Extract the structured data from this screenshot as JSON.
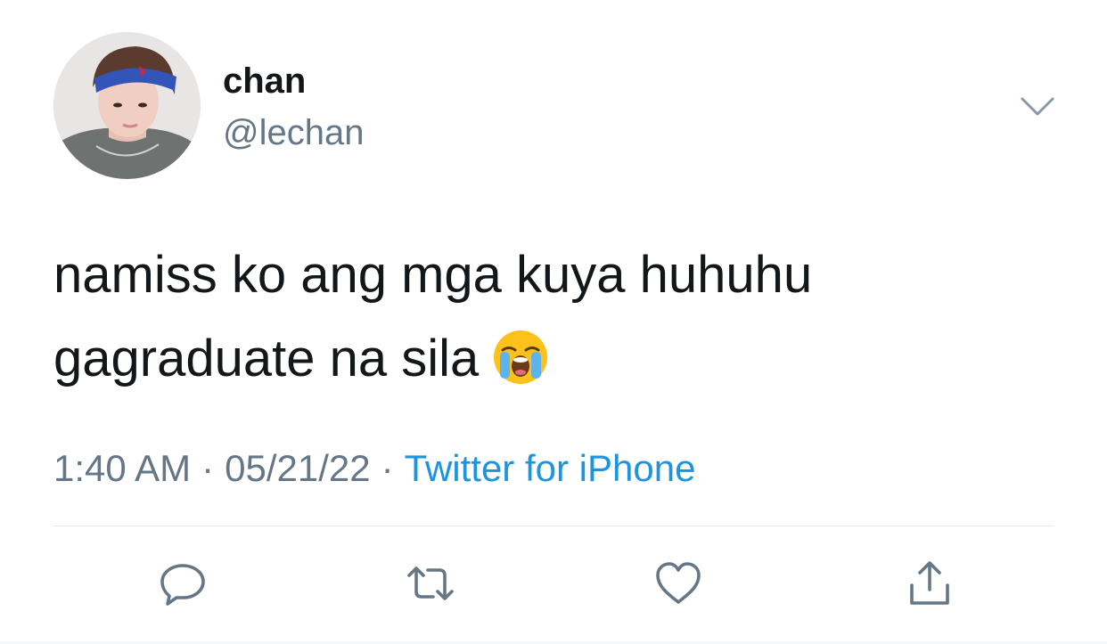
{
  "user": {
    "display_name": "chan",
    "handle": "@lechan",
    "avatar_icon": "profile-photo"
  },
  "tweet": {
    "text_lines": [
      "namiss ko ang mga kuya huhuhu",
      "gagraduate na sila"
    ],
    "emoji": "loudly-crying-face-emoji",
    "time": "1:40 AM",
    "separator": "·",
    "date": "05/21/22",
    "source": "Twitter for iPhone"
  },
  "actions": [
    {
      "name": "reply",
      "icon": "reply-icon"
    },
    {
      "name": "retweet",
      "icon": "retweet-icon"
    },
    {
      "name": "like",
      "icon": "heart-icon"
    },
    {
      "name": "share",
      "icon": "share-icon"
    }
  ],
  "colors": {
    "text_primary": "#14171a",
    "text_secondary": "#657786",
    "link": "#1b95e0",
    "divider": "#e1e8ed"
  }
}
